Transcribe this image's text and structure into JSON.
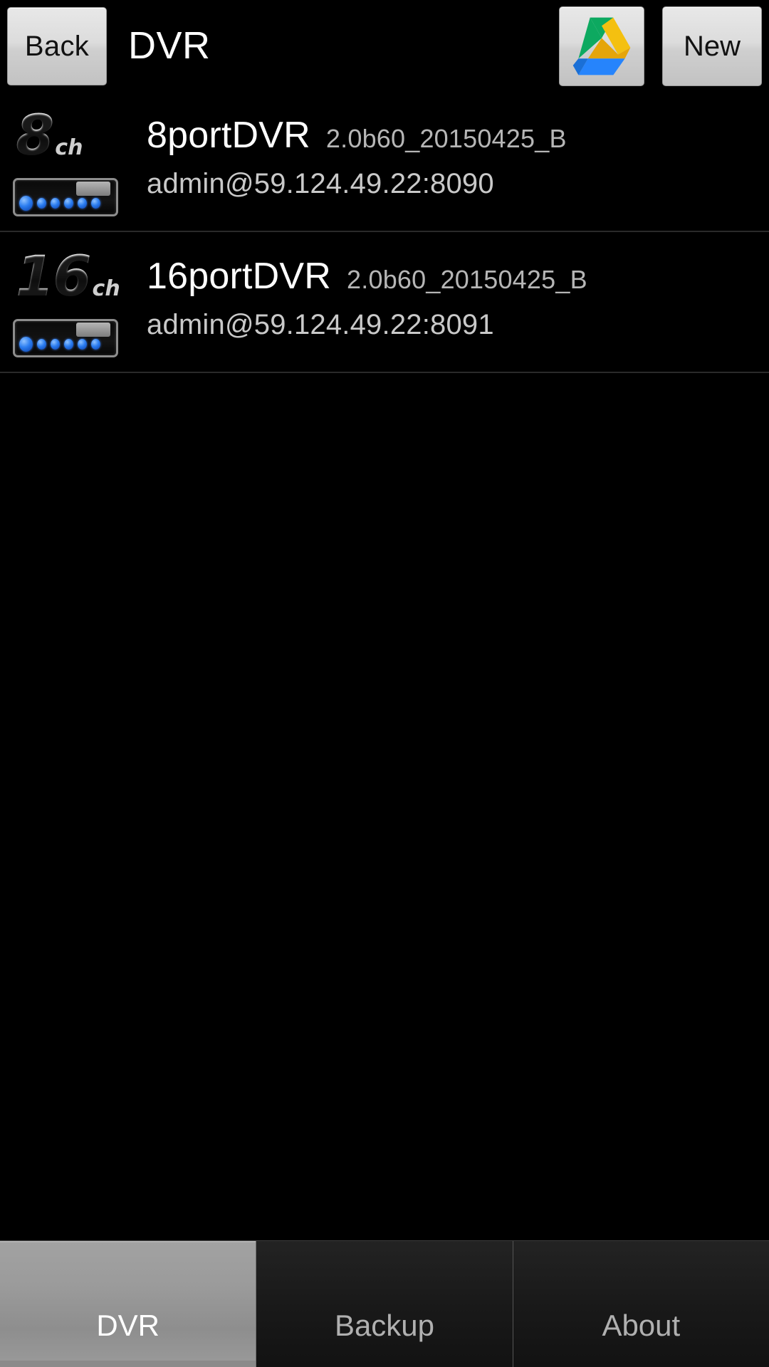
{
  "header": {
    "back_label": "Back",
    "title": "DVR",
    "drive_icon": "google-drive-icon",
    "new_label": "New"
  },
  "list": {
    "rows": [
      {
        "channels": "8",
        "channels_suffix": "ch",
        "name": "8portDVR",
        "version": "2.0b60_20150425_B",
        "address": "admin@59.124.49.22:8090"
      },
      {
        "channels": "16",
        "channels_suffix": "ch",
        "name": "16portDVR",
        "version": "2.0b60_20150425_B",
        "address": "admin@59.124.49.22:8091"
      }
    ]
  },
  "tabbar": {
    "tabs": [
      {
        "label": "DVR",
        "selected": true
      },
      {
        "label": "Backup",
        "selected": false
      },
      {
        "label": "About",
        "selected": false
      }
    ]
  },
  "colors": {
    "background": "#000000",
    "title_text": "#ffffff",
    "secondary_text": "#b6b6b6",
    "button_face": "#dcdcdc",
    "tab_selected": "#9b9b9b",
    "led_blue": "#2b7df0",
    "drive_green": "#0da960",
    "drive_yellow": "#f4c010",
    "drive_blue": "#2684fc"
  }
}
